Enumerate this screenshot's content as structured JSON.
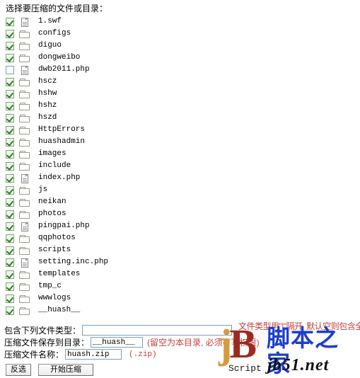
{
  "heading": "选择要压缩的文件或目录：",
  "files": [
    {
      "name": "1.swf",
      "type": "file",
      "checked": true
    },
    {
      "name": "configs",
      "type": "folder",
      "checked": true
    },
    {
      "name": "diguo",
      "type": "folder",
      "checked": true
    },
    {
      "name": "dongweibo",
      "type": "folder",
      "checked": true
    },
    {
      "name": "dwb2011.php",
      "type": "file",
      "checked": false
    },
    {
      "name": "hscz",
      "type": "folder",
      "checked": true
    },
    {
      "name": "hshw",
      "type": "folder",
      "checked": true
    },
    {
      "name": "hshz",
      "type": "folder",
      "checked": true
    },
    {
      "name": "hszd",
      "type": "folder",
      "checked": true
    },
    {
      "name": "HttpErrors",
      "type": "folder",
      "checked": true
    },
    {
      "name": "huashadmin",
      "type": "folder",
      "checked": true
    },
    {
      "name": "images",
      "type": "folder",
      "checked": true
    },
    {
      "name": "include",
      "type": "folder",
      "checked": true
    },
    {
      "name": "index.php",
      "type": "file",
      "checked": true
    },
    {
      "name": "js",
      "type": "folder",
      "checked": true
    },
    {
      "name": "neikan",
      "type": "folder",
      "checked": true
    },
    {
      "name": "photos",
      "type": "folder",
      "checked": true
    },
    {
      "name": "pingpai.php",
      "type": "file",
      "checked": true
    },
    {
      "name": "qqphotos",
      "type": "folder",
      "checked": true
    },
    {
      "name": "scripts",
      "type": "folder",
      "checked": true
    },
    {
      "name": "setting.inc.php",
      "type": "file",
      "checked": true
    },
    {
      "name": "templates",
      "type": "folder",
      "checked": true
    },
    {
      "name": "tmp_c",
      "type": "folder",
      "checked": true
    },
    {
      "name": "wwwlogs",
      "type": "folder",
      "checked": true
    },
    {
      "name": "__huash__",
      "type": "folder",
      "checked": true
    }
  ],
  "form": {
    "file_types_label": "包含下列文件类型：",
    "file_types_value": "",
    "save_dir_label": "压缩文件保存到目录：",
    "save_dir_value": "__huash__",
    "save_dir_hint": "(留空为本目录, 必须有写权限)",
    "zip_name_label": "压缩文件名称：",
    "zip_name_value": "huash.zip",
    "zip_name_suffix": "(.zip)",
    "occluded_note": "文件类型用\"|\"隔开, 默认空则包含全部"
  },
  "buttons": {
    "invert_label": "反选",
    "start_label": "开始压缩"
  },
  "watermark": {
    "logo_j": "j",
    "logo_b": "B",
    "script_text": "Script",
    "brand_cn": "脚本之家",
    "brand_url": "jb51.net"
  },
  "colors": {
    "hint_red": "#c2413d",
    "brand_blue": "#1c3fd0",
    "logo_orange": "#d79a3c",
    "logo_red": "#9c2a21",
    "checkbox_border": "#7f9db9",
    "check_green": "#2f7d26"
  }
}
